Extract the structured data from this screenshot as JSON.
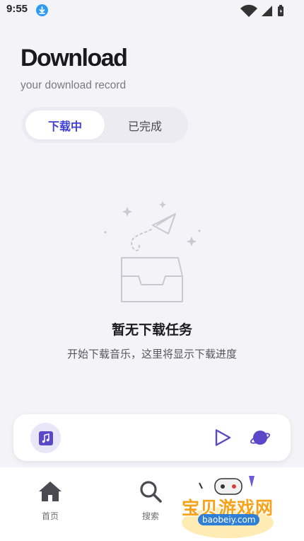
{
  "status_bar": {
    "time": "9:55"
  },
  "header": {
    "title": "Download",
    "subtitle": "your download record"
  },
  "tabs": [
    {
      "label": "下载中",
      "active": true
    },
    {
      "label": "已完成",
      "active": false
    }
  ],
  "empty_state": {
    "title": "暂无下载任务",
    "description": "开始下载音乐，这里将显示下载进度"
  },
  "player": {
    "cover_icon": "music-note-icon",
    "play_icon": "play-icon",
    "extra_icon": "planet-icon"
  },
  "bottom_nav": {
    "items": [
      {
        "label": "首页",
        "icon": "home-icon"
      },
      {
        "label": "搜索",
        "icon": "search-icon"
      }
    ]
  },
  "watermark": {
    "text": "宝贝游戏网",
    "url": "baobeiy.com"
  },
  "colors": {
    "accent": "#3e3fd7",
    "background": "#f4f4f8",
    "player_icon": "#5a48c9"
  }
}
